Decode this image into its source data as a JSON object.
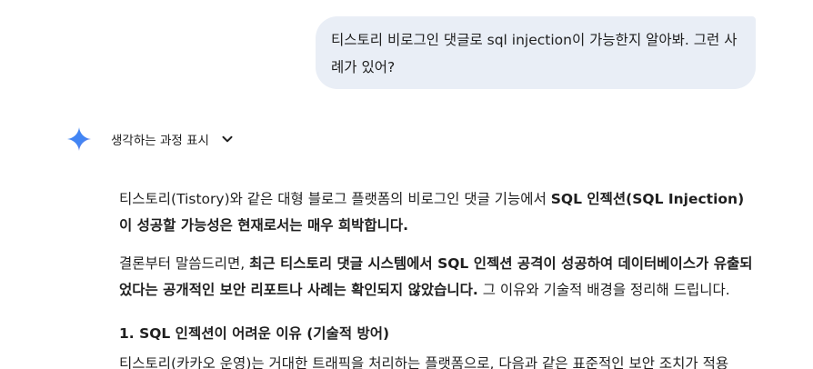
{
  "user_message": {
    "text": "티스토리 비로그인 댓글로 sql injection이 가능한지 알아봐. 그런 사례가 있어?"
  },
  "assistant": {
    "icon": "gemini-sparkle-icon",
    "accent_colors": [
      "#4285f4",
      "#9b72cb",
      "#d96570"
    ],
    "thinking_label": "생각하는 과정 표시",
    "para1": {
      "t1": "티스토리(Tistory)와 같은 대형 블로그 플랫폼의 비로그인 댓글 기능에서 ",
      "b1": "SQL 인젝션(SQL Injection)이 성공할 가능성은 현재로서는 매우 희박합니다."
    },
    "para2": {
      "t1": "결론부터 말씀드리면, ",
      "b1": "최근 티스토리 댓글 시스템에서 SQL 인젝션 공격이 성공하여 데이터베이스가 유출되었다는 공개적인 보안 리포트나 사례는 확인되지 않았습니다.",
      "t2": " 그 이유와 기술적 배경을 정리해 드립니다."
    },
    "heading1": "1. SQL 인젝션이 어려운 이유 (기술적 방어)",
    "para3_partial": "티스토리(카카오 운영)는 거대한 트래픽을 처리하는 플랫폼으로, 다음과 같은 표준적인 보안 조치가 적용"
  }
}
